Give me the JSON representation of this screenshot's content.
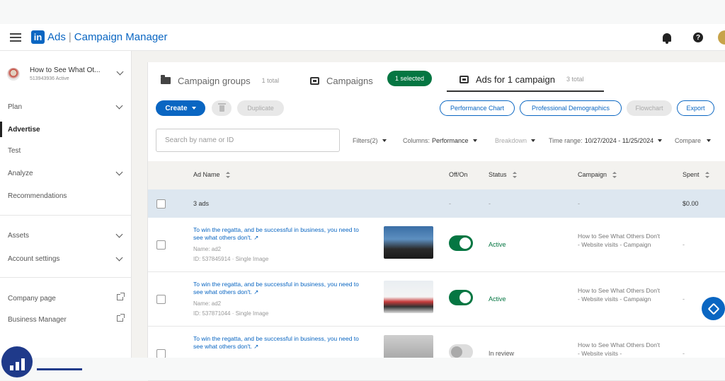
{
  "header": {
    "logo_text": "in",
    "app": "Ads",
    "separator": "|",
    "product": "Campaign Manager"
  },
  "account": {
    "name": "How to See What Ot...",
    "sub": "513943936 Active"
  },
  "nav": [
    {
      "label": "Plan"
    },
    {
      "label": "Advertise"
    },
    {
      "label": "Test"
    },
    {
      "label": "Analyze"
    },
    {
      "label": "Recommendations"
    },
    {
      "label": "Assets"
    },
    {
      "label": "Account settings"
    },
    {
      "label": "Company page"
    },
    {
      "label": "Business Manager"
    }
  ],
  "tabs": {
    "groups": {
      "label": "Campaign groups",
      "count": "1 total"
    },
    "campaigns": {
      "label": "Campaigns",
      "badge": "1 selected"
    },
    "ads": {
      "label": "Ads for 1 campaign",
      "count": "3 total"
    }
  },
  "toolbar": {
    "create": "Create",
    "duplicate": "Duplicate",
    "performance_chart": "Performance Chart",
    "demographics": "Professional Demographics",
    "flowchart": "Flowchart",
    "export": "Export"
  },
  "search": {
    "placeholder": "Search by name or ID"
  },
  "filters": {
    "filters": "Filters(2)",
    "columns_label": "Columns:",
    "columns_value": "Performance",
    "breakdown": "Breakdown",
    "time_label": "Time range:",
    "time_value": "10/27/2024 - 11/25/2024",
    "compare": "Compare"
  },
  "table": {
    "headers": {
      "name": "Ad Name",
      "offon": "Off/On",
      "status": "Status",
      "campaign": "Campaign",
      "spent": "Spent"
    },
    "summary": {
      "label": "3 ads",
      "offon": "-",
      "status": "-",
      "campaign": "-",
      "spent": "$0.00"
    },
    "rows": [
      {
        "title": "To win the regatta, and be successful in business, you need to see what others don't. ↗",
        "name": "Name: ad2",
        "id": "ID: 537845914 · Single Image",
        "status": "Active",
        "campaign": "How to See What Others Don't - Website visits - Campaign",
        "spent": "-"
      },
      {
        "title": "To win the regatta, and be successful in business, you need to see what others don't. ↗",
        "name": "Name: ad2",
        "id": "ID: 537871044 · Single Image",
        "status": "Active",
        "campaign": "How to See What Others Don't - Website visits - Campaign",
        "spent": "-"
      },
      {
        "title": "To win the regatta, and be successful in business, you need to see what others don't. ↗",
        "name": "",
        "id": "",
        "status": "In review",
        "campaign": "How to See What Others Don't - Website visits -",
        "spent": "-"
      }
    ]
  },
  "colors": {
    "brand": "#0a66c2",
    "active_green": "#057642"
  }
}
